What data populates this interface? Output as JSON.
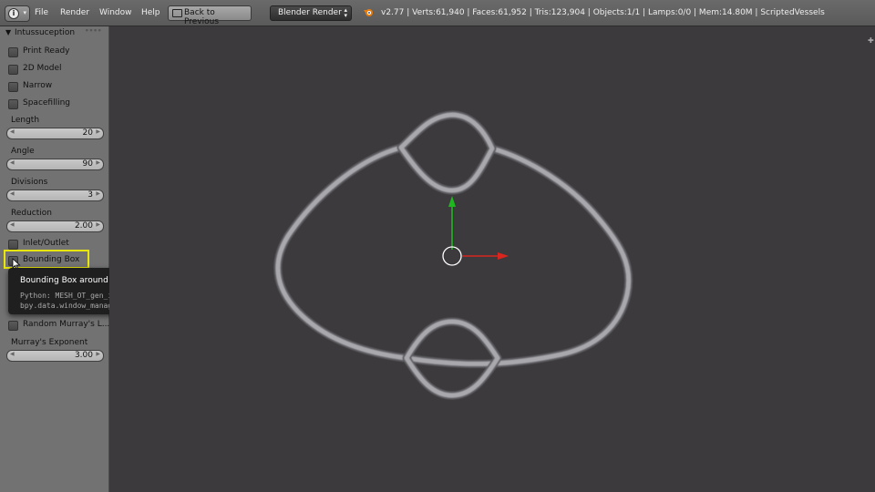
{
  "header": {
    "menus": [
      "File",
      "Render",
      "Window",
      "Help"
    ],
    "back_button": "Back to Previous",
    "render_engine": "Blender Render",
    "stats": "v2.77 | Verts:61,940 | Faces:61,952 | Tris:123,904 | Objects:1/1 | Lamps:0/0 | Mem:14.80M | ScriptedVessels",
    "icons": [
      "editor-type-icon",
      "blender-logo-icon",
      "screen-icon"
    ]
  },
  "panel": {
    "title": "Intussuception",
    "checkboxes": {
      "print_ready": "Print Ready",
      "model_2d": "2D Model",
      "narrow": "Narrow",
      "spacefilling": "Spacefilling",
      "inlet_outlet": "Inlet/Outlet",
      "bounding_box": "Bounding Box",
      "random_murray": "Random Murray's L..."
    },
    "fields": {
      "length": {
        "label": "Length",
        "value": "20"
      },
      "angle": {
        "label": "Angle",
        "value": "90"
      },
      "divisions": {
        "label": "Divisions",
        "value": "3"
      },
      "reduction": {
        "label": "Reduction",
        "value": "2.00"
      },
      "murray_exponent": {
        "label": "Murray's Exponent",
        "value": "3.00"
      }
    }
  },
  "tooltip": {
    "title": "Bounding Box around Structure",
    "python": "Python: MESH_OT_gen_intus.boundBox",
    "path": "bpy.data.window_managers[\"WinMan\"] ... boundBox"
  },
  "viewport": {
    "colors": {
      "background": "#3c3a3c",
      "mesh": "#a9a8ad",
      "x_axis": "#d8261f",
      "y_axis": "#1fb81f"
    }
  }
}
